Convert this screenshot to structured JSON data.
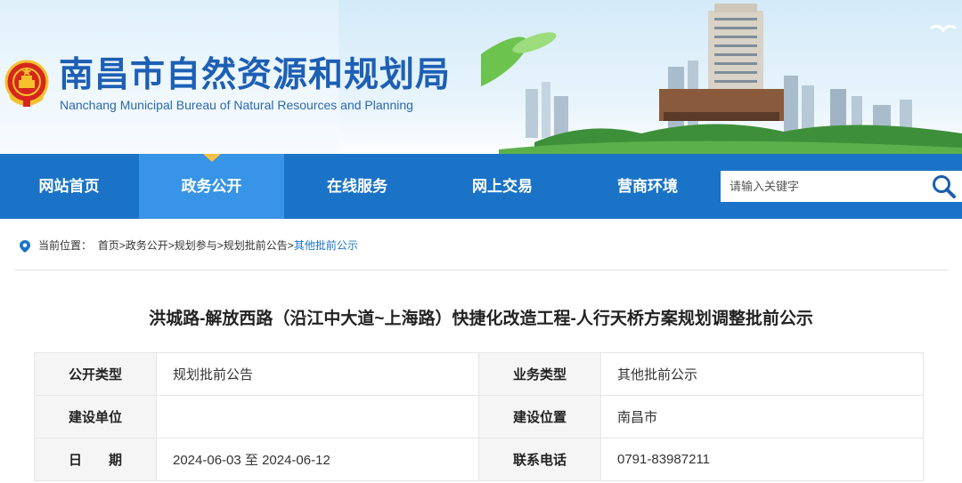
{
  "header": {
    "title": "南昌市自然资源和规划局",
    "subtitle": "Nanchang Municipal Bureau of Natural Resources and Planning"
  },
  "nav": {
    "items": [
      {
        "label": "网站首页"
      },
      {
        "label": "政务公开"
      },
      {
        "label": "在线服务"
      },
      {
        "label": "网上交易"
      },
      {
        "label": "营商环境"
      }
    ],
    "active": "政务公开"
  },
  "search": {
    "placeholder": "请输入关键字"
  },
  "breadcrumb": {
    "prefix": "当前位置：",
    "items": [
      "首页",
      "政务公开",
      "规划参与",
      "规划批前公告"
    ],
    "current": "其他批前公示",
    "separator": ">"
  },
  "article": {
    "title": "洪城路-解放西路（沿江中大道~上海路）快捷化改造工程-人行天桥方案规划调整批前公示",
    "rows": [
      {
        "k1": "公开类型",
        "v1": "规划批前公告",
        "k2": "业务类型",
        "v2": "其他批前公示"
      },
      {
        "k1": "建设单位",
        "v1": "",
        "k2": "建设位置",
        "v2": "南昌市"
      },
      {
        "k1": "日　　期",
        "v1": "2024-06-03 至 2024-06-12",
        "k2": "联系电话",
        "v2": "0791-83987211"
      }
    ]
  },
  "colors": {
    "nav_bg": "#1a73c7",
    "nav_active_bg": "#3794e6",
    "nav_caret": "#f6c243",
    "title_blue": "#1d5fb4",
    "emblem_red": "#d7261e",
    "emblem_gold": "#f5c22e"
  },
  "icons": {
    "emblem": "national-emblem-icon",
    "search": "magnifier-icon",
    "location": "location-pin-icon"
  }
}
